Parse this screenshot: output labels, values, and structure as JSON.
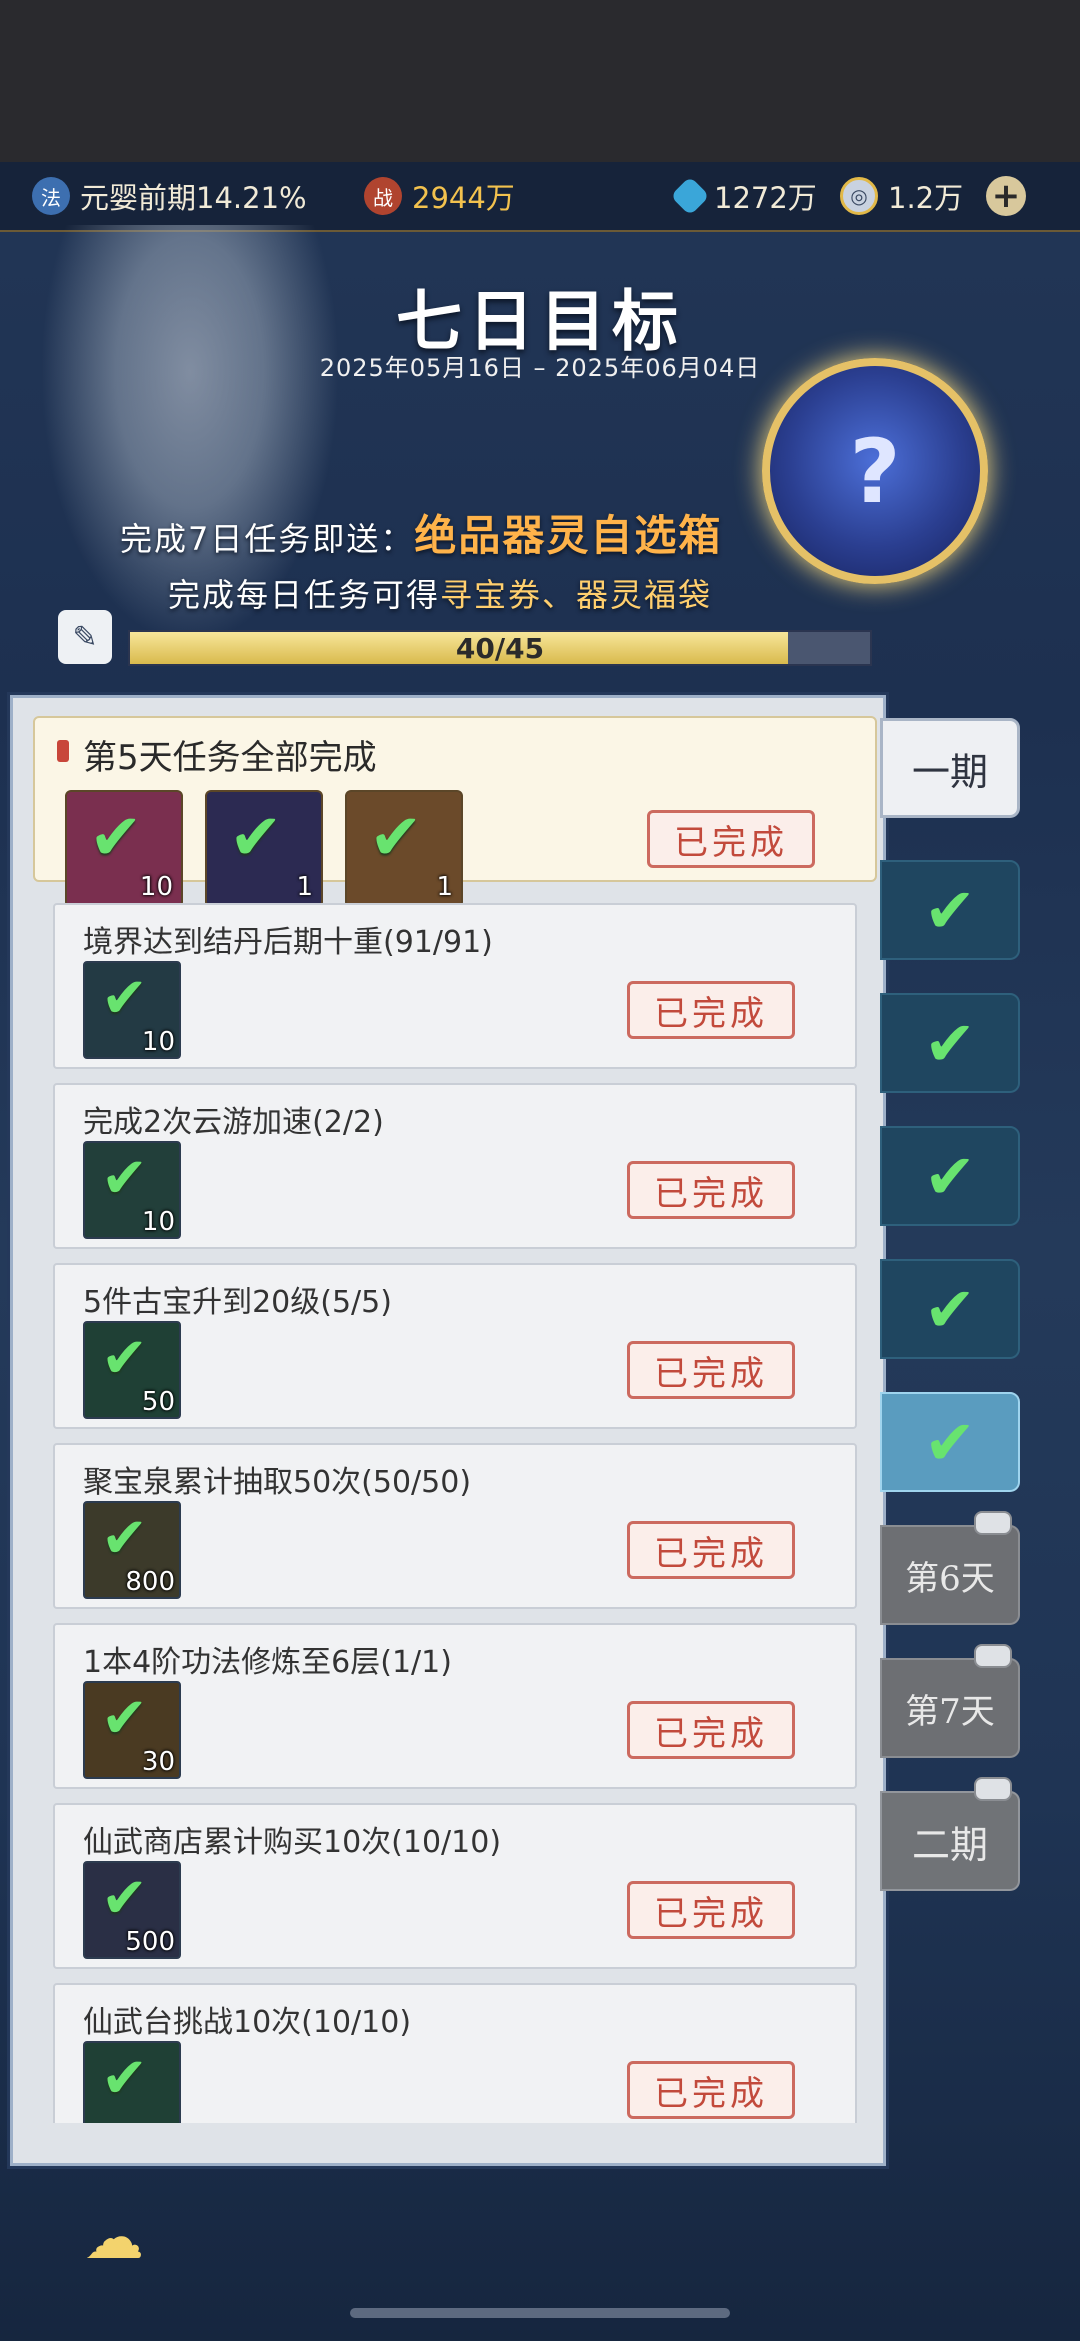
{
  "resources": {
    "realm_icon": "法",
    "realm": "元婴前期14.21%",
    "power_icon": "战",
    "power": "2944万",
    "crystal": "1272万",
    "coin": "1.2万",
    "add": "+"
  },
  "banner": {
    "title": "七日目标",
    "date_range": "2025年05月16日 – 2025年06月04日",
    "orb_symbol": "?",
    "promo1_prefix": "完成7日任务即送：",
    "promo1_highlight": "绝品器灵自选箱",
    "promo2_prefix": "完成每日任务可得",
    "promo2_highlight": "寻宝券、器灵福袋",
    "progress_text": "40/45",
    "progress_fraction": 0.889
  },
  "summary": {
    "title": "第5天任务全部完成",
    "rewards": [
      {
        "count": "10",
        "icon": "voucher-icon",
        "color": "#7a2f4f"
      },
      {
        "count": "1",
        "icon": "spirit-bag-icon",
        "color": "#2c2a52"
      },
      {
        "count": "1",
        "icon": "treasure-chest-icon",
        "color": "#6b4a2a"
      }
    ],
    "status": "已完成"
  },
  "tasks": [
    {
      "title": "境界达到结丹后期十重(91/91)",
      "count": "10",
      "status": "已完成",
      "icon_color": "#233a44"
    },
    {
      "title": "完成2次云游加速(2/2)",
      "count": "10",
      "status": "已完成",
      "icon_color": "#223f3a"
    },
    {
      "title": "5件古宝升到20级(5/5)",
      "count": "50",
      "status": "已完成",
      "icon_color": "#1f4035"
    },
    {
      "title": "聚宝泉累计抽取50次(50/50)",
      "count": "800",
      "status": "已完成",
      "icon_color": "#3c3a2a"
    },
    {
      "title": "1本4阶功法修炼至6层(1/1)",
      "count": "30",
      "status": "已完成",
      "icon_color": "#4a3a22"
    },
    {
      "title": "仙武商店累计购买10次(10/10)",
      "count": "500",
      "status": "已完成",
      "icon_color": "#2a2f45"
    },
    {
      "title": "仙武台挑战10次(10/10)",
      "count": "",
      "status": "已完成",
      "icon_color": "#1f4035"
    }
  ],
  "tabs": {
    "period1": "一期",
    "day6": "第6天",
    "day7": "第7天",
    "period2": "二期"
  },
  "colors": {
    "check": "#68e36f",
    "gold": "#f3c24e",
    "done_red": "#c24a3c"
  }
}
